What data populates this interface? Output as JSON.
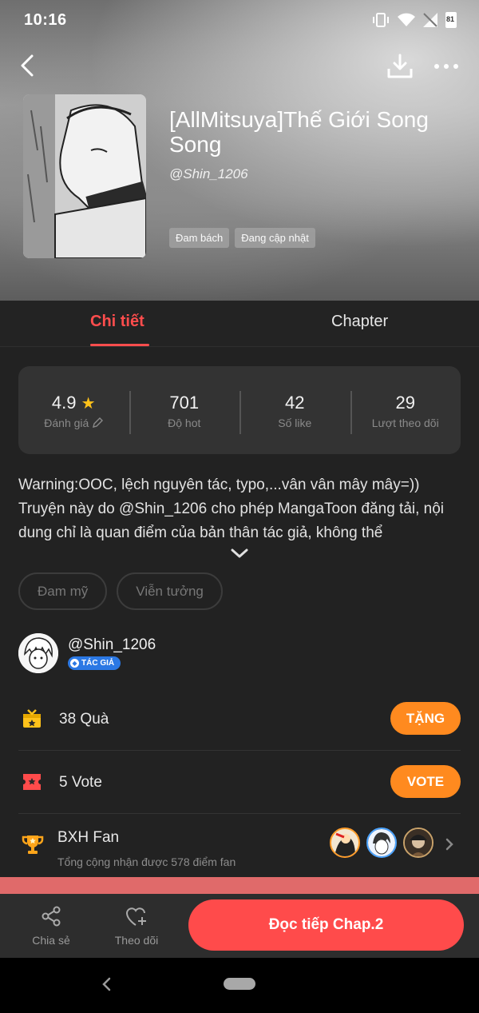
{
  "status_bar": {
    "time": "10:16",
    "battery": "81"
  },
  "book": {
    "title": "[AllMitsuya]Thế Giới Song Song",
    "author": "@Shin_1206",
    "tags": [
      "Đam bách",
      "Đang cập nhật"
    ]
  },
  "tabs": {
    "detail": "Chi tiết",
    "chapter": "Chapter"
  },
  "stats": {
    "rating": {
      "value": "4.9",
      "label": "Đánh giá"
    },
    "hot": {
      "value": "701",
      "label": "Độ hot"
    },
    "likes": {
      "value": "42",
      "label": "Số like"
    },
    "followers": {
      "value": "29",
      "label": "Lượt theo dõi"
    }
  },
  "description": "Warning:OOC, lệch nguyên tác, typo,...vân vân mây mây=)) Truyện này do @Shin_1206 cho phép MangaToon đăng tải, nội dung chỉ là quan điểm của bản thân tác giả, không thể",
  "genres": [
    "Đam mỹ",
    "Viễn tưởng"
  ],
  "author_section": {
    "name": "@Shin_1206",
    "badge": "TÁC GIẢ"
  },
  "gifts": {
    "text": "38 Quà",
    "button": "TẶNG"
  },
  "votes": {
    "text": "5 Vote",
    "button": "VOTE"
  },
  "fan_ranking": {
    "title": "BXH Fan",
    "subtitle": "Tổng cộng nhận được 578 điểm fan"
  },
  "bottom_bar": {
    "share": "Chia sẻ",
    "follow": "Theo dõi",
    "read": "Đọc tiếp Chap.2"
  },
  "colors": {
    "accent": "#ff4d4d",
    "orange": "#ff8a1f",
    "background": "#222222"
  }
}
